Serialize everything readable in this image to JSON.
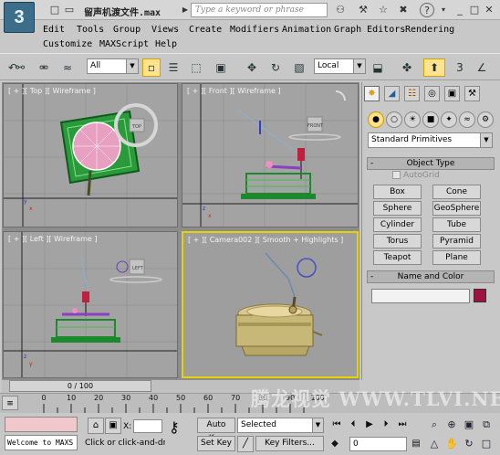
{
  "app": {
    "logo": "3",
    "file_title": "留声机渡文件.max",
    "search_placeholder": "Type a keyword or phrase"
  },
  "titlebar_icons": [
    "new-file-icon",
    "open-folder-icon",
    "save-icon",
    "undo-icon",
    "redo-icon",
    "search-binoculars-icon",
    "star-icon",
    "tools-icon",
    "close-x-icon",
    "help-icon"
  ],
  "menus": [
    "Edit",
    "Tools",
    "Group",
    "Views",
    "Create",
    "Modifiers",
    "Animation",
    "Graph Editors",
    "Rendering",
    "Customize",
    "MAXScript",
    "Help"
  ],
  "toolbar": {
    "selection_filter": "All",
    "reference_coord": "Local"
  },
  "viewports": {
    "top": {
      "label": "[ + ][ Top ][ Wireframe ]",
      "viewcube": "TOP"
    },
    "front": {
      "label": "[ + ][ Front ][ Wireframe ]",
      "viewcube": "FRONT"
    },
    "left": {
      "label": "[ + ][ Left ][ Wireframe ]",
      "viewcube": "LEFT"
    },
    "camera": {
      "label": "[ + ][ Camera002 ][ Smooth + Highlights ]"
    }
  },
  "command_panel": {
    "category": "Standard Primitives",
    "object_type_header": "Object Type",
    "autogrid": "AutoGrid",
    "primitives": [
      "Box",
      "Cone",
      "Sphere",
      "GeoSphere",
      "Cylinder",
      "Tube",
      "Torus",
      "Pyramid",
      "Teapot",
      "Plane"
    ],
    "name_color_header": "Name and Color",
    "object_color": "#a01040"
  },
  "timeline": {
    "slider": "0 / 100",
    "ticks": [
      "0",
      "10",
      "20",
      "30",
      "40",
      "50",
      "60",
      "70",
      "80",
      "90",
      "100"
    ]
  },
  "status": {
    "listener_text": "Welcome to MAXS",
    "prompt": "Click or click-and-dra",
    "x_label": "X:",
    "auto_key": "Auto Key",
    "set_key": "Set Key",
    "selected": "Selected",
    "key_filters": "Key Filters...",
    "frame": "0"
  },
  "watermark": "腾龙视觉 WWW.TLVI.NET"
}
